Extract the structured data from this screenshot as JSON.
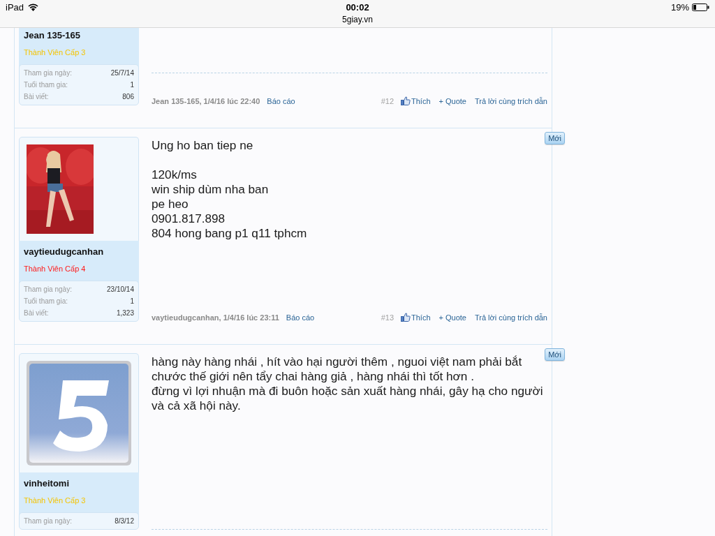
{
  "status_bar": {
    "device": "iPad",
    "time": "00:02",
    "site": "5giay.vn",
    "battery": "19%"
  },
  "posts": [
    {
      "user": {
        "name": "Jean 135-165",
        "rank": "Thành Viên Cấp 3",
        "color": "#f5c400",
        "stats": [
          {
            "label": "Tham gia ngày:",
            "value": "25/7/14"
          },
          {
            "label": "Tuổi tham gia:",
            "value": "1"
          },
          {
            "label": "Bài viết:",
            "value": "806"
          }
        ]
      },
      "signature_divider": true,
      "footer": {
        "author_date": "Jean 135-165, 1/4/16 lúc 22:40",
        "report": "Báo cáo",
        "number": "#12",
        "like": "Thích",
        "quote": "+ Quote",
        "reply": "Trả lời cùng trích dẫn"
      }
    },
    {
      "user": {
        "name": "vaytieudugcanhan",
        "rank": "Thành Viên Cấp 4",
        "color": "#ff1a1a",
        "stats": [
          {
            "label": "Tham gia ngày:",
            "value": "23/10/14"
          },
          {
            "label": "Tuổi tham gia:",
            "value": "1"
          },
          {
            "label": "Bài viết:",
            "value": "1,323"
          }
        ]
      },
      "new_label": "Mới",
      "paragraphs": [
        "Ung ho ban tiep ne",
        "120k/ms\nwin ship dùm nha ban\npe heo\n0901.817.898\n804 hong bang p1 q11 tphcm"
      ],
      "signature_divider": false,
      "footer": {
        "author_date": "vaytieudugcanhan, 1/4/16 lúc 23:11",
        "report": "Báo cáo",
        "number": "#13",
        "like": "Thích",
        "quote": "+ Quote",
        "reply": "Trả lời cùng trích dẫn"
      }
    },
    {
      "user": {
        "name": "vinheitomi",
        "rank": "Thành Viên Cấp 3",
        "color": "#f5c400",
        "stats": [
          {
            "label": "Tham gia ngày:",
            "value": "8/3/12"
          }
        ]
      },
      "new_label": "Mới",
      "paragraphs": [
        "hàng này hàng nhái , hít vào hại người thêm , nguoi việt nam phải bắt chước thế giới nên tẩy chai hàng giả , hàng nhái thì tốt hơn .\nđừng vì lợi nhuận mà đi buôn hoặc sản xuất hàng nhái, gây hạ cho người và cả xã hội này."
      ],
      "signature_divider": true
    }
  ]
}
